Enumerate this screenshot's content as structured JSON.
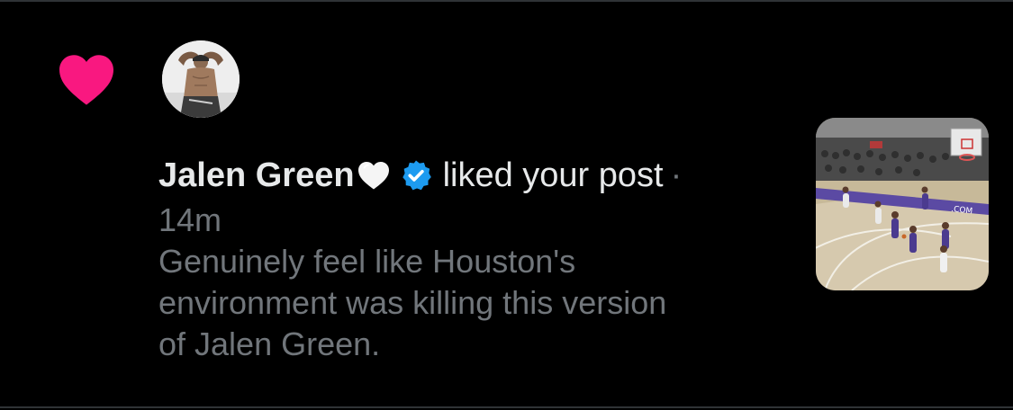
{
  "notification": {
    "type_icon": "heart-icon",
    "accent_color": "#f91880",
    "user": {
      "display_name": "Jalen Green",
      "name_emoji": "white-heart",
      "verified": true,
      "verified_color": "#1d9bf0"
    },
    "action_text": "liked your post",
    "separator": "·",
    "time": "14m",
    "post_text": "Genuinely feel like Houston's environment was killing this version of Jalen Green.",
    "thumbnail": "basketball-game-photo"
  },
  "colors": {
    "background": "#000000",
    "primary_text": "#e7e9ea",
    "secondary_text": "#71767b"
  }
}
